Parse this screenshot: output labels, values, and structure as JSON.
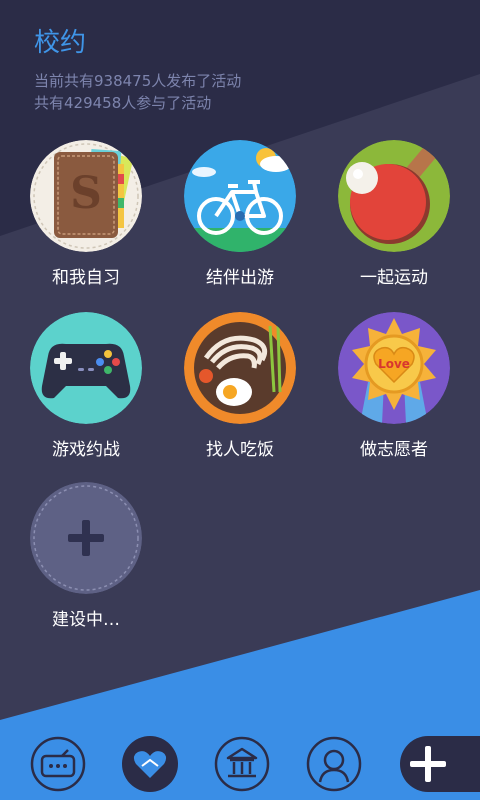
{
  "app": {
    "title": "校约"
  },
  "stats": {
    "line1": "当前共有938475人发布了活动",
    "line2": "共有429458人参与了活动"
  },
  "activities": [
    {
      "label": "和我自习",
      "icon": "notebook-icon"
    },
    {
      "label": "结伴出游",
      "icon": "bicycle-icon"
    },
    {
      "label": "一起运动",
      "icon": "ping-pong-icon"
    },
    {
      "label": "游戏约战",
      "icon": "gamepad-icon"
    },
    {
      "label": "找人吃饭",
      "icon": "noodle-bowl-icon"
    },
    {
      "label": "做志愿者",
      "icon": "love-medal-icon"
    },
    {
      "label": "建设中…",
      "icon": "plus-icon"
    }
  ],
  "medal_text": "Love",
  "tabs": [
    {
      "name": "message-tab",
      "icon": "chat-bubble-icon"
    },
    {
      "name": "activity-tab",
      "icon": "heart-handshake-icon",
      "selected": true
    },
    {
      "name": "campus-tab",
      "icon": "building-icon"
    },
    {
      "name": "profile-tab",
      "icon": "person-icon"
    },
    {
      "name": "add-tab",
      "icon": "plus-icon"
    }
  ],
  "colors": {
    "background": "#2b2c47",
    "accent": "#3a8ee6",
    "title": "#3f95e8"
  }
}
